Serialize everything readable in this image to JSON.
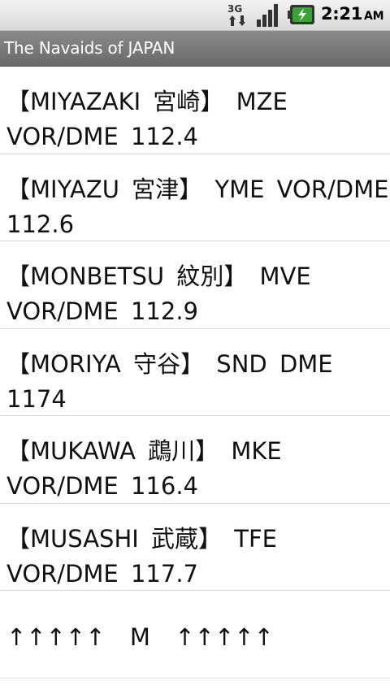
{
  "status_bar": {
    "network_type": "3G",
    "time": "2:21",
    "ampm": "AM",
    "icons": [
      "3g-data-icon",
      "signal-strength-icon",
      "battery-charging-icon"
    ],
    "battery_color": "#3aa336"
  },
  "app": {
    "title": "The Navaids of JAPAN"
  },
  "list": {
    "items": [
      {
        "text": "【MIYAZAKI 宮崎】 MZE VOR/DME 112.4"
      },
      {
        "text": "【MIYAZU 宮津】 YME VOR/DME 112.6"
      },
      {
        "text": "【MONBETSU 紋別】 MVE VOR/DME 112.9"
      },
      {
        "text": "【MORIYA 守谷】 SND DME 1174"
      },
      {
        "text": "【MUKAWA 鵡川】 MKE VOR/DME 116.4"
      },
      {
        "text": "【MUSASHI 武蔵】 TFE VOR/DME 117.7"
      },
      {
        "text": "↑↑↑↑↑  M  ↑↑↑↑↑"
      }
    ]
  }
}
